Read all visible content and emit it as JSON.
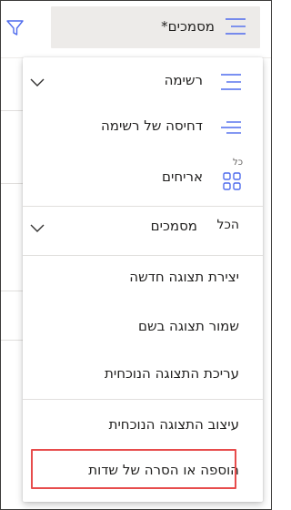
{
  "toolbar": {
    "view_name": "מסמכים*",
    "filter_icon": "filter-icon",
    "view_icon": "list-lines-icon"
  },
  "menu": {
    "views": [
      {
        "label": "רשימה",
        "icon": "list-icon",
        "expandable": true
      },
      {
        "label": "דחיסה של רשימה",
        "icon": "compact-list-icon",
        "expandable": false
      },
      {
        "label": "אריחים",
        "icon": "tiles-icon",
        "badge": "כל",
        "expandable": false
      }
    ],
    "all_section": {
      "label": "מסמכים",
      "prefix": "הכל",
      "expandable": true
    },
    "actions": [
      {
        "label": "יצירת תצוגה חדשה"
      },
      {
        "label": "שמור תצוגה בשם"
      },
      {
        "label": "עריכת התצוגה הנוכחית"
      }
    ],
    "format_actions": [
      {
        "label": "עיצוב התצוגה הנוכחית"
      },
      {
        "label": "הוספה או הסרה של שדות"
      }
    ]
  },
  "colors": {
    "accent": "#4f6bed",
    "highlight": "#e74c4c",
    "selector_bg": "#edebe9"
  }
}
